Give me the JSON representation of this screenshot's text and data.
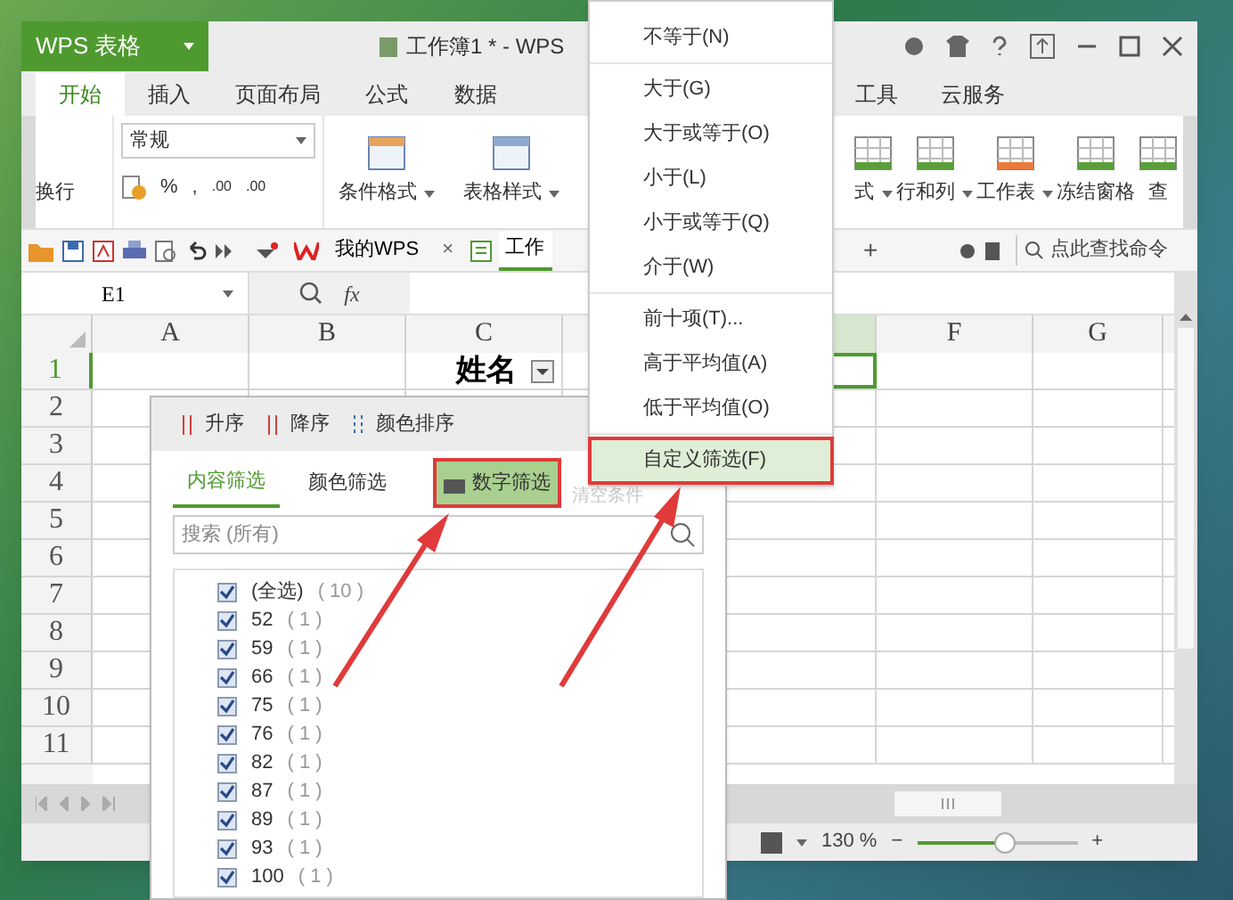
{
  "app": {
    "logo": "WPS 表格",
    "title": "工作簿1 * - WPS"
  },
  "menu_tabs": [
    {
      "label": "开始",
      "selected": true
    },
    {
      "label": "插入",
      "selected": false
    },
    {
      "label": "页面布局",
      "selected": false
    },
    {
      "label": "公式",
      "selected": false
    },
    {
      "label": "数据",
      "selected": false
    },
    {
      "label": "工具",
      "selected": false
    },
    {
      "label": "云服务",
      "selected": false
    }
  ],
  "ribbon": {
    "wrap_label": "换行",
    "number_format": "常规",
    "percent": "%",
    "comma": ",",
    "decimals": [
      ".00",
      ".00"
    ],
    "tools": [
      "条件格式",
      "表格样式"
    ],
    "right_tools": [
      "式",
      "行和列",
      "工作表",
      "冻结窗格",
      "查"
    ]
  },
  "quick_bar": {
    "tabs": [
      {
        "label": "我的WPS",
        "selected": false
      },
      {
        "label": "工作",
        "selected": true
      }
    ],
    "close": "×",
    "new_tab": "+",
    "search_placeholder": "点此查找命令"
  },
  "formula_bar": {
    "name_box": "E1",
    "fx": "fx"
  },
  "sheet": {
    "columns": [
      "A",
      "B",
      "C",
      "",
      "",
      "F",
      "G"
    ],
    "rows": [
      "1",
      "2",
      "3",
      "4",
      "5",
      "6",
      "7",
      "8",
      "9",
      "10",
      "11"
    ],
    "header_cell": "姓名"
  },
  "filter_panel": {
    "sort": [
      "升序",
      "降序",
      "颜色排序"
    ],
    "tabs": [
      {
        "label": "内容筛选",
        "selected": true
      },
      {
        "label": "颜色筛选",
        "selected": false
      }
    ],
    "number_filter": {
      "label": "数字筛选",
      "marked": true
    },
    "clear": {
      "label": "清空条件",
      "disabled": true
    },
    "search_placeholder": "搜索 (所有)",
    "items": [
      {
        "label": "(全选)",
        "count": "( 10 )",
        "checked": true
      },
      {
        "label": "52",
        "count": "( 1 )",
        "checked": true
      },
      {
        "label": "59",
        "count": "( 1 )",
        "checked": true
      },
      {
        "label": "66",
        "count": "( 1 )",
        "checked": true
      },
      {
        "label": "75",
        "count": "( 1 )",
        "checked": true
      },
      {
        "label": "76",
        "count": "( 1 )",
        "checked": true
      },
      {
        "label": "82",
        "count": "( 1 )",
        "checked": true
      },
      {
        "label": "87",
        "count": "( 1 )",
        "checked": true
      },
      {
        "label": "89",
        "count": "( 1 )",
        "checked": true
      },
      {
        "label": "93",
        "count": "( 1 )",
        "checked": true
      },
      {
        "label": "100",
        "count": "( 1 )",
        "checked": true
      }
    ]
  },
  "number_menu": [
    [
      {
        "label": "不等于(N)",
        "selected": false,
        "marked": false
      }
    ],
    [
      {
        "label": "大于(G)",
        "selected": false,
        "marked": false
      },
      {
        "label": "大于或等于(O)",
        "selected": false,
        "marked": false
      },
      {
        "label": "小于(L)",
        "selected": false,
        "marked": false
      },
      {
        "label": "小于或等于(Q)",
        "selected": false,
        "marked": false
      },
      {
        "label": "介于(W)",
        "selected": false,
        "marked": false
      }
    ],
    [
      {
        "label": "前十项(T)...",
        "selected": false,
        "marked": false
      },
      {
        "label": "高于平均值(A)",
        "selected": false,
        "marked": false
      },
      {
        "label": "低于平均值(O)",
        "selected": false,
        "marked": false
      }
    ],
    [
      {
        "label": "自定义筛选(F)",
        "selected": true,
        "marked": true
      }
    ]
  ],
  "status_bar": {
    "zoom": "130 %",
    "zoom_minus": "−",
    "zoom_plus": "+",
    "level": 0.55
  }
}
